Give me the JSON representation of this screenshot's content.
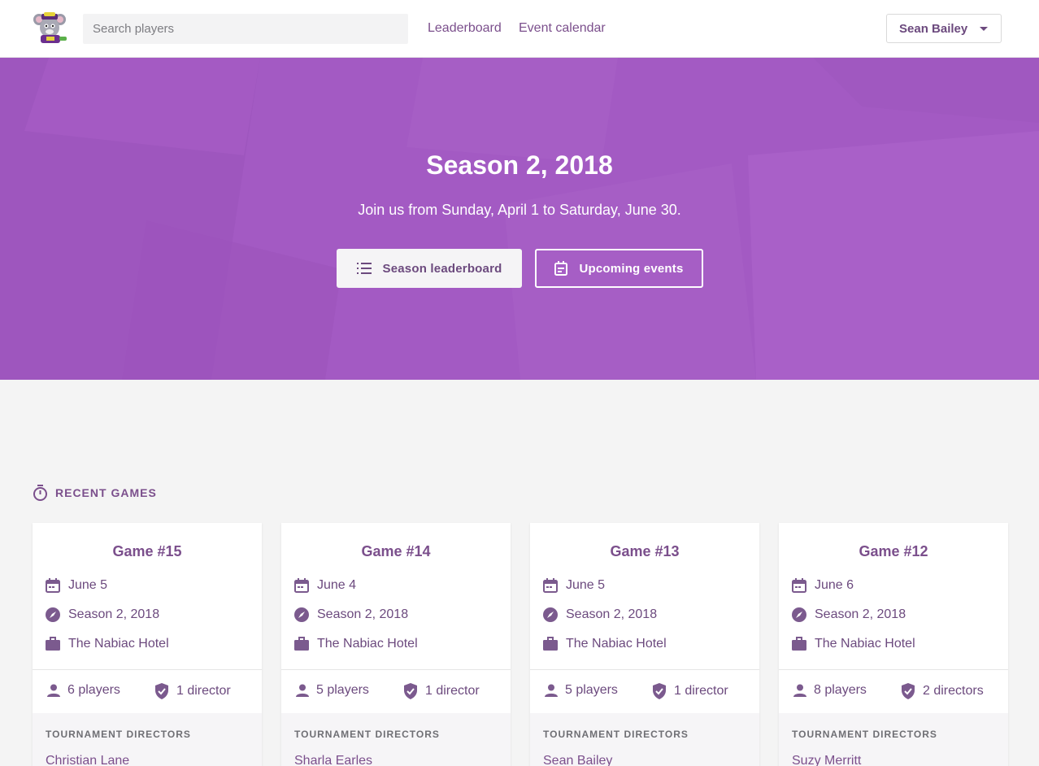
{
  "header": {
    "search_placeholder": "Search players",
    "nav": [
      "Leaderboard",
      "Event calendar"
    ],
    "user_name": "Sean Bailey"
  },
  "hero": {
    "title": "Season 2, 2018",
    "subtitle": "Join us from Sunday, April 1 to Saturday, June 30.",
    "primary_button": "Season leaderboard",
    "secondary_button": "Upcoming events"
  },
  "recent_games": {
    "heading": "RECENT GAMES",
    "directors_label": "TOURNAMENT DIRECTORS",
    "games": [
      {
        "title": "Game #15",
        "date": "June 5",
        "season": "Season 2, 2018",
        "venue": "The Nabiac Hotel",
        "players": "6 players",
        "directors": "1 director",
        "director_name": "Christian Lane"
      },
      {
        "title": "Game #14",
        "date": "June 4",
        "season": "Season 2, 2018",
        "venue": "The Nabiac Hotel",
        "players": "5 players",
        "directors": "1 director",
        "director_name": "Sharla Earles"
      },
      {
        "title": "Game #13",
        "date": "June 5",
        "season": "Season 2, 2018",
        "venue": "The Nabiac Hotel",
        "players": "5 players",
        "directors": "1 director",
        "director_name": "Sean Bailey"
      },
      {
        "title": "Game #12",
        "date": "June 6",
        "season": "Season 2, 2018",
        "venue": "The Nabiac Hotel",
        "players": "8 players",
        "directors": "2 directors",
        "director_name": "Suzy Merritt"
      }
    ]
  },
  "colors": {
    "brand_purple": "#a35ac3",
    "text_purple": "#7b4f8c",
    "icon_purple": "#7b5a8e"
  }
}
